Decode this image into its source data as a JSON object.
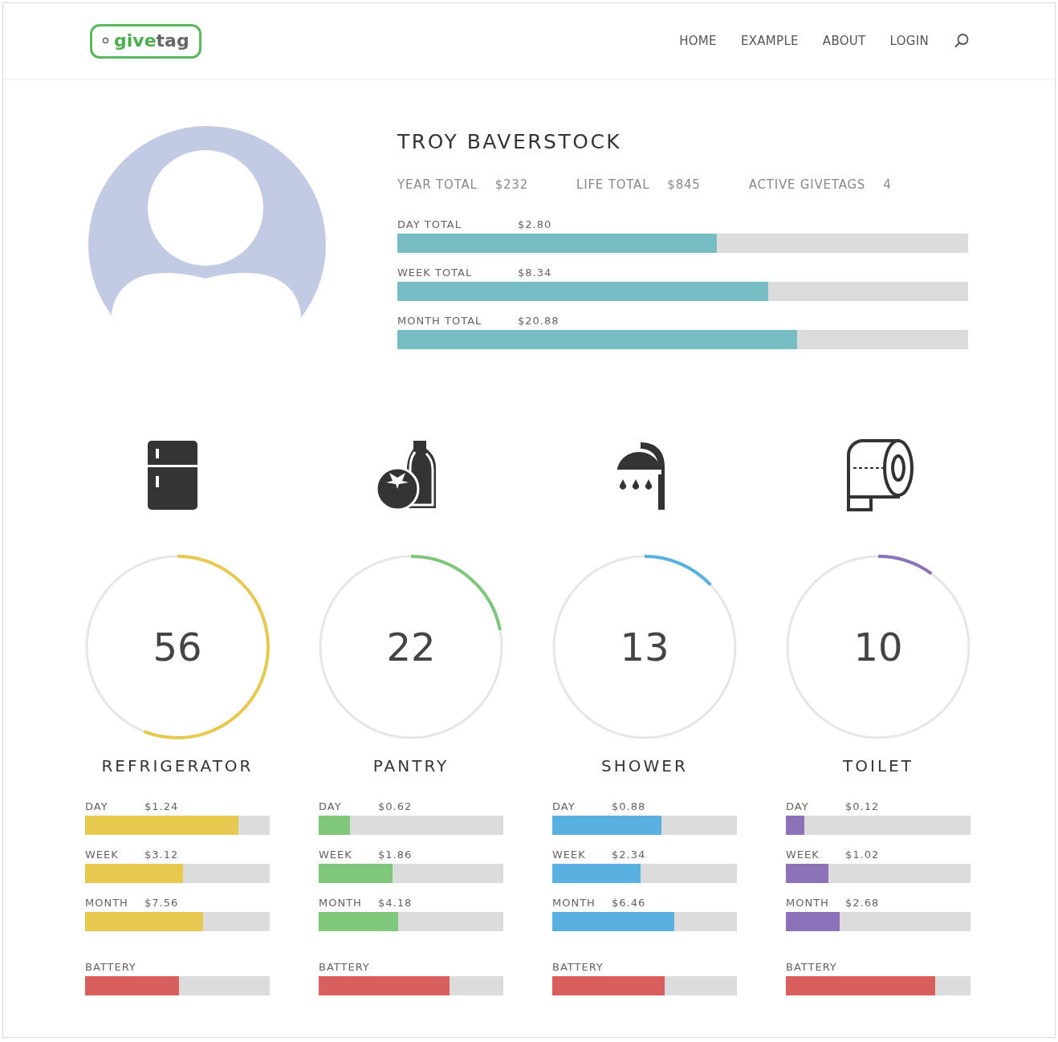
{
  "header": {
    "logo": {
      "accent": "give",
      "rest": "tag"
    },
    "nav": [
      {
        "label": "HOME"
      },
      {
        "label": "EXAMPLE"
      },
      {
        "label": "ABOUT"
      },
      {
        "label": "LOGIN"
      }
    ]
  },
  "profile": {
    "name": "TROY BAVERSTOCK",
    "stats": [
      {
        "label": "YEAR TOTAL",
        "value": "$232"
      },
      {
        "label": "LIFE TOTAL",
        "value": "$845"
      },
      {
        "label": "ACTIVE GIVETAGS",
        "value": "4"
      }
    ],
    "totals": [
      {
        "label": "DAY TOTAL",
        "value": "$2.80",
        "level": 0.56
      },
      {
        "label": "WEEK TOTAL",
        "value": "$8.34",
        "level": 0.65
      },
      {
        "label": "MONTH TOTAL",
        "value": "$20.88",
        "level": 0.7
      }
    ]
  },
  "categories": [
    {
      "kind": "fridge",
      "name": "REFRIGERATOR",
      "count": "56",
      "color": "#e8c94f",
      "bars": [
        {
          "label": "DAY",
          "value": "$1.24",
          "level": 0.83
        },
        {
          "label": "WEEK",
          "value": "$3.12",
          "level": 0.53
        },
        {
          "label": "MONTH",
          "value": "$7.56",
          "level": 0.64
        }
      ],
      "battery": {
        "label": "BATTERY",
        "level": 0.51
      }
    },
    {
      "kind": "pantry",
      "name": "PANTRY",
      "count": "22",
      "color": "#7dc67a",
      "bars": [
        {
          "label": "DAY",
          "value": "$0.62",
          "level": 0.17
        },
        {
          "label": "WEEK",
          "value": "$1.86",
          "level": 0.4
        },
        {
          "label": "MONTH",
          "value": "$4.18",
          "level": 0.43
        }
      ],
      "battery": {
        "label": "BATTERY",
        "level": 0.71
      }
    },
    {
      "kind": "shower",
      "name": "SHOWER",
      "count": "13",
      "color": "#5ab0e0",
      "bars": [
        {
          "label": "DAY",
          "value": "$0.88",
          "level": 0.59
        },
        {
          "label": "WEEK",
          "value": "$2.34",
          "level": 0.48
        },
        {
          "label": "MONTH",
          "value": "$6.46",
          "level": 0.66
        }
      ],
      "battery": {
        "label": "BATTERY",
        "level": 0.61
      }
    },
    {
      "kind": "toilet",
      "name": "TOILET",
      "count": "10",
      "color": "#8c72b8",
      "bars": [
        {
          "label": "DAY",
          "value": "$0.12",
          "level": 0.1
        },
        {
          "label": "WEEK",
          "value": "$1.02",
          "level": 0.23
        },
        {
          "label": "MONTH",
          "value": "$2.68",
          "level": 0.29
        }
      ],
      "battery": {
        "label": "BATTERY",
        "level": 0.81
      }
    }
  ]
}
